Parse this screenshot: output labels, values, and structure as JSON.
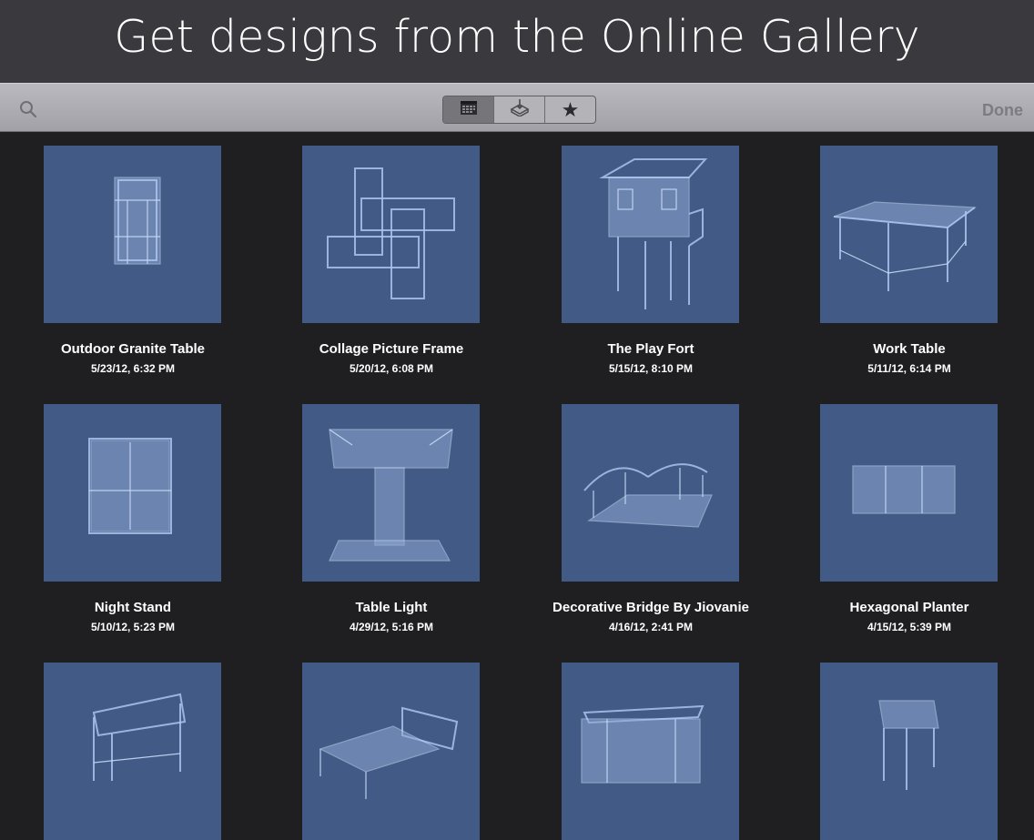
{
  "header": {
    "title": "Get designs from the Online Gallery"
  },
  "toolbar": {
    "segments": [
      {
        "icon": "calendar-icon",
        "active": true
      },
      {
        "icon": "download-tray-icon",
        "active": false
      },
      {
        "icon": "star-icon",
        "active": false
      }
    ],
    "done_label": "Done",
    "search_icon": "search-icon"
  },
  "gallery": {
    "items": [
      {
        "title": "Outdoor Granite Table",
        "date": "5/23/12, 6:32 PM"
      },
      {
        "title": "Collage Picture Frame",
        "date": "5/20/12, 6:08 PM"
      },
      {
        "title": "The Play Fort",
        "date": "5/15/12, 8:10 PM"
      },
      {
        "title": "Work Table",
        "date": "5/11/12, 6:14 PM"
      },
      {
        "title": "Night Stand",
        "date": "5/10/12, 5:23 PM"
      },
      {
        "title": "Table Light",
        "date": "4/29/12, 5:16 PM"
      },
      {
        "title": "Decorative Bridge By Jiovanie",
        "date": "4/16/12, 2:41 PM"
      },
      {
        "title": "Hexagonal Planter",
        "date": "4/15/12, 5:39 PM"
      },
      {
        "title": "",
        "date": ""
      },
      {
        "title": "",
        "date": ""
      },
      {
        "title": "",
        "date": ""
      },
      {
        "title": "",
        "date": ""
      }
    ]
  },
  "colors": {
    "background": "#1f1f22",
    "header": "#3a3a3e",
    "thumbnail": "#425a86",
    "wireframe": "#aac4ee"
  }
}
